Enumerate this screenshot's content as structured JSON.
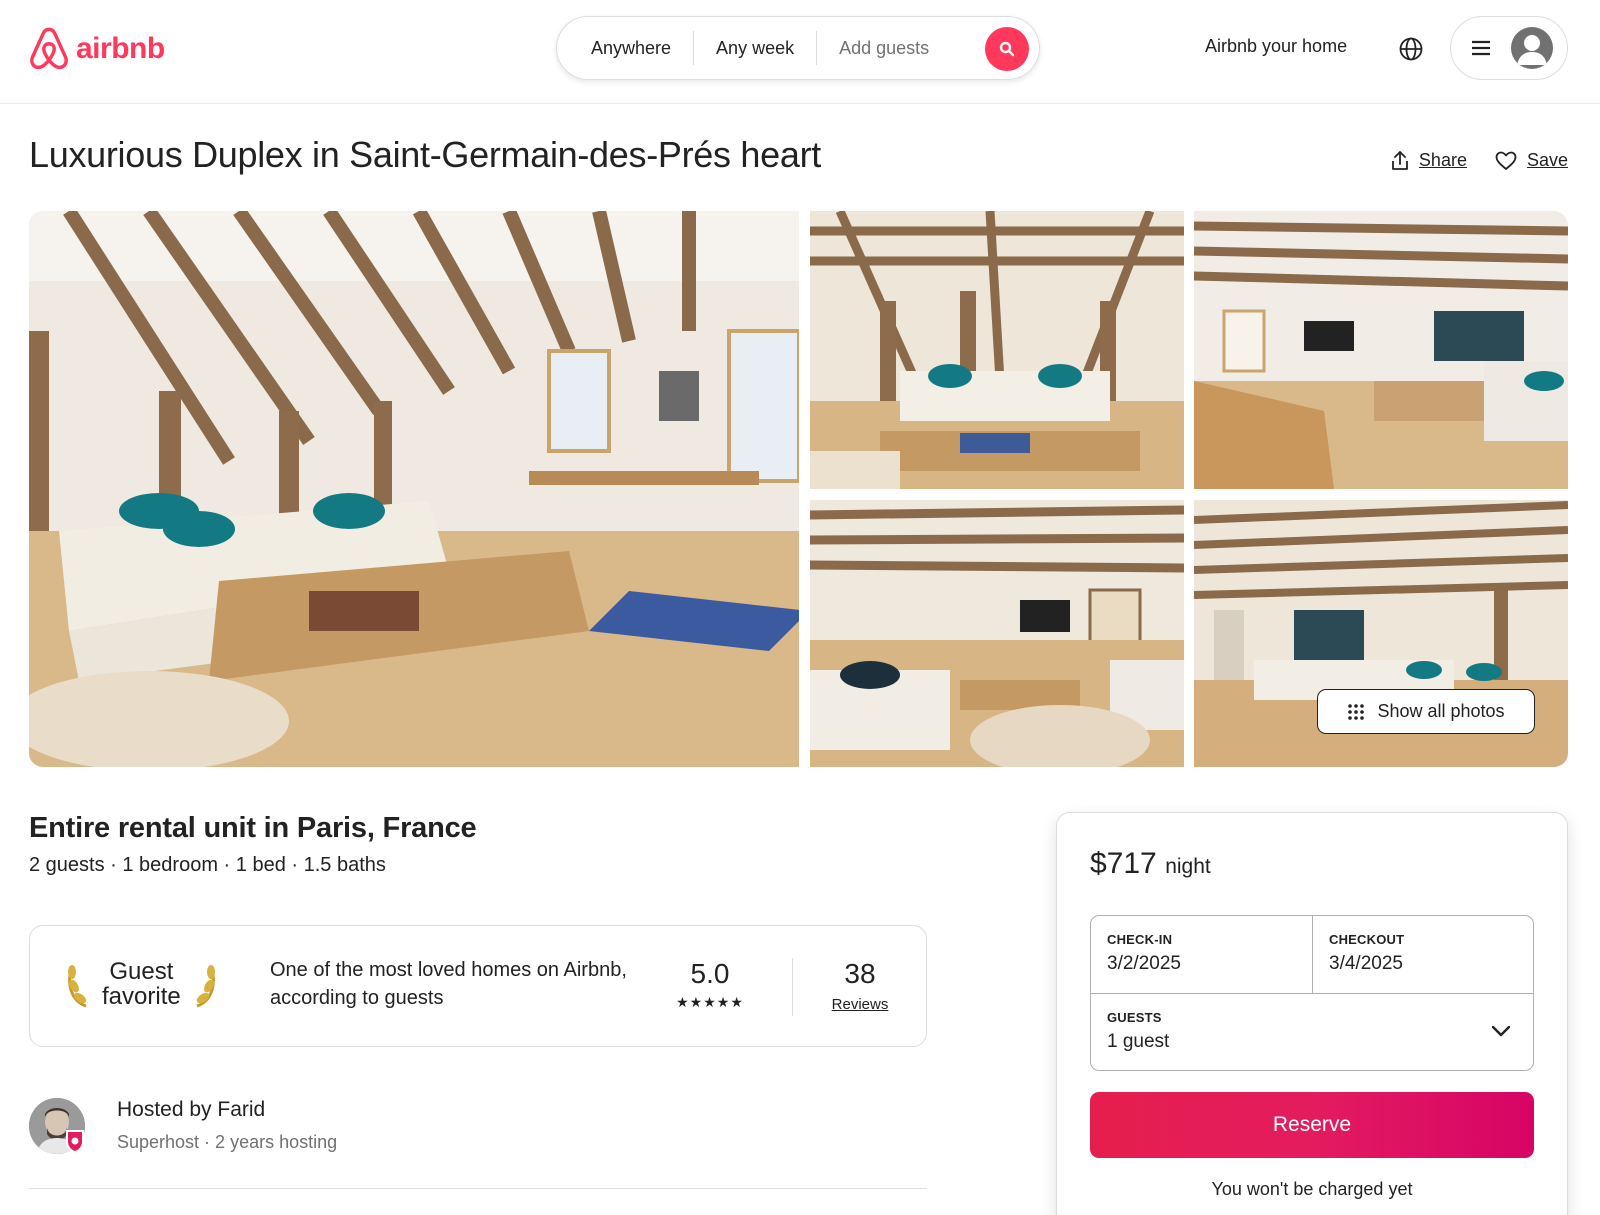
{
  "header": {
    "logo_text": "airbnb",
    "search": {
      "where": "Anywhere",
      "when": "Any week",
      "guests_placeholder": "Add guests"
    },
    "host_link": "Airbnb your home",
    "icons": [
      "airbnb-logo-icon",
      "search-icon",
      "globe-icon",
      "menu-icon",
      "user-avatar-icon"
    ]
  },
  "listing": {
    "title": "Luxurious Duplex in Saint-Germain-des-Prés heart",
    "share_label": "Share",
    "save_label": "Save",
    "show_all_photos": "Show all photos",
    "subtitle": "Entire rental unit in Paris, France",
    "facts": "2 guests · 1 bedroom · 1 bed · 1.5 baths"
  },
  "guest_favorite": {
    "label_line1": "Guest",
    "label_line2": "favorite",
    "description": "One of the most loved homes on Airbnb, according to guests",
    "rating": "5.0",
    "stars": "★★★★★",
    "reviews_count": "38",
    "reviews_label": "Reviews"
  },
  "host": {
    "name_line": "Hosted by Farid",
    "meta": "Superhost · 2 years hosting"
  },
  "booking": {
    "price": "$717",
    "per": "night",
    "checkin_label": "CHECK-IN",
    "checkin_value": "3/2/2025",
    "checkout_label": "CHECKOUT",
    "checkout_value": "3/4/2025",
    "guests_label": "GUESTS",
    "guests_value": "1 guest",
    "reserve_label": "Reserve",
    "note": "You won't be charged yet"
  },
  "colors": {
    "brand": "#FF385C",
    "reserve_gradient": [
      "#E61E4D",
      "#E31C5F",
      "#D70466"
    ],
    "text": "#222222",
    "muted": "#717171",
    "border": "#DDDDDD"
  }
}
